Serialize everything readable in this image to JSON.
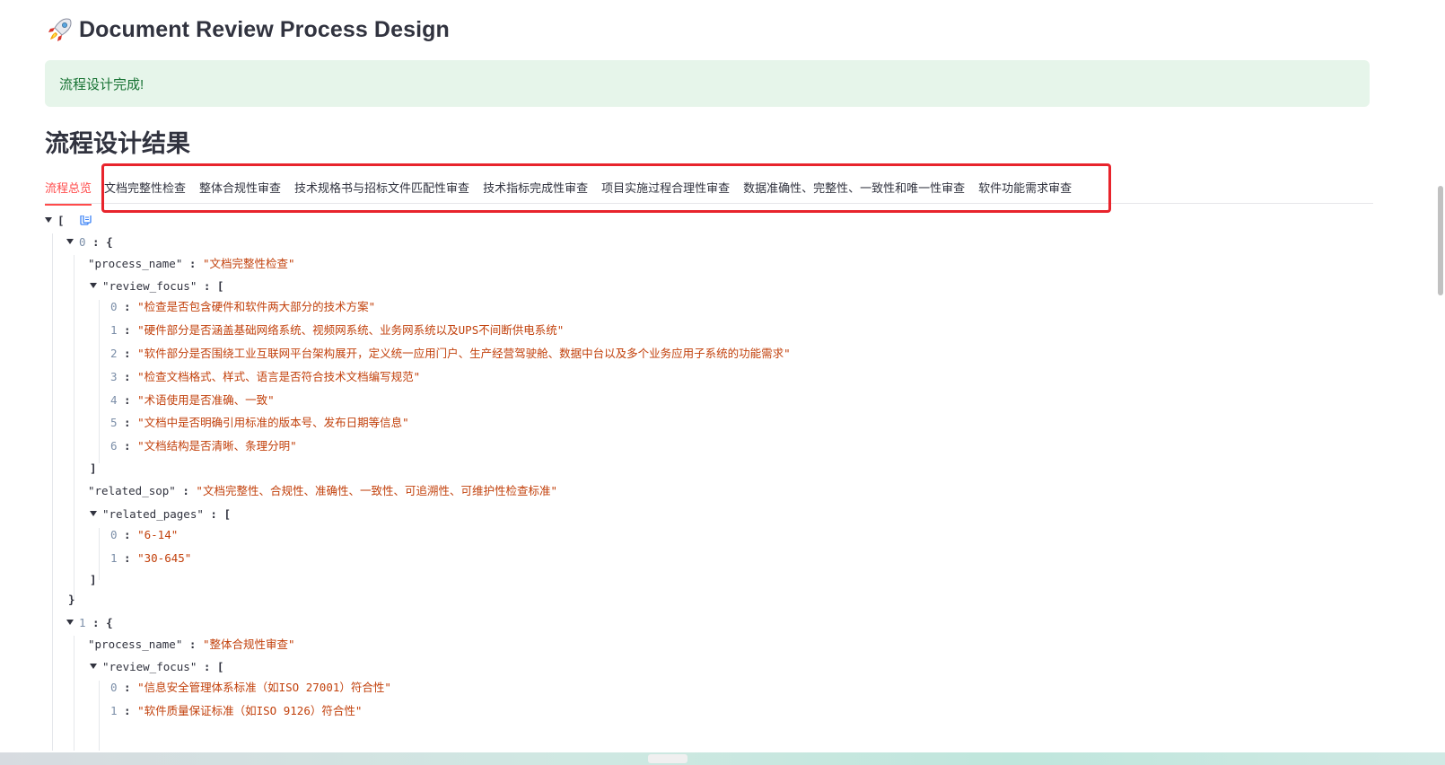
{
  "header": {
    "title": "Document Review Process Design"
  },
  "alert": {
    "message": "流程设计完成!"
  },
  "section": {
    "title": "流程设计结果"
  },
  "tabs": [
    {
      "label": "流程总览"
    },
    {
      "label": "文档完整性检查"
    },
    {
      "label": "整体合规性审查"
    },
    {
      "label": "技术规格书与招标文件匹配性审查"
    },
    {
      "label": "技术指标完成性审查"
    },
    {
      "label": "项目实施过程合理性审查"
    },
    {
      "label": "数据准确性、完整性、一致性和唯一性审查"
    },
    {
      "label": "软件功能需求审查"
    }
  ],
  "json_view": {
    "root_open": "[",
    "item0": {
      "index": "0",
      "process_name_key": "\"process_name\"",
      "process_name_val": "\"文档完整性检查\"",
      "review_focus_key": "\"review_focus\"",
      "review_focus": [
        {
          "i": "0",
          "v": "\"检查是否包含硬件和软件两大部分的技术方案\""
        },
        {
          "i": "1",
          "v": "\"硬件部分是否涵盖基础网络系统、视频网系统、业务网系统以及UPS不间断供电系统\""
        },
        {
          "i": "2",
          "v": "\"软件部分是否围绕工业互联网平台架构展开，定义统一应用门户、生产经营驾驶舱、数据中台以及多个业务应用子系统的功能需求\""
        },
        {
          "i": "3",
          "v": "\"检查文档格式、样式、语言是否符合技术文档编写规范\""
        },
        {
          "i": "4",
          "v": "\"术语使用是否准确、一致\""
        },
        {
          "i": "5",
          "v": "\"文档中是否明确引用标准的版本号、发布日期等信息\""
        },
        {
          "i": "6",
          "v": "\"文档结构是否清晰、条理分明\""
        }
      ],
      "related_sop_key": "\"related_sop\"",
      "related_sop_val": "\"文档完整性、合规性、准确性、一致性、可追溯性、可维护性检查标准\"",
      "related_pages_key": "\"related_pages\"",
      "related_pages": [
        {
          "i": "0",
          "v": "\"6-14\""
        },
        {
          "i": "1",
          "v": "\"30-645\""
        }
      ]
    },
    "item1": {
      "index": "1",
      "process_name_key": "\"process_name\"",
      "process_name_val": "\"整体合规性审查\"",
      "review_focus_key": "\"review_focus\"",
      "review_focus": [
        {
          "i": "0",
          "v": "\"信息安全管理体系标准（如ISO 27001）符合性\""
        },
        {
          "i": "1",
          "v": "\"软件质量保证标准（如ISO 9126）符合性\""
        }
      ]
    }
  },
  "colors": {
    "accent": "#ff4b4b",
    "success_bg": "#e6f5ea",
    "success_text": "#177233",
    "highlight": "#e8242c",
    "json_string": "#c2410c",
    "json_index": "#7b8ea8"
  },
  "icons": {
    "title": "rocket-icon",
    "copy": "copy-icon",
    "expand": "caret-down-icon"
  }
}
